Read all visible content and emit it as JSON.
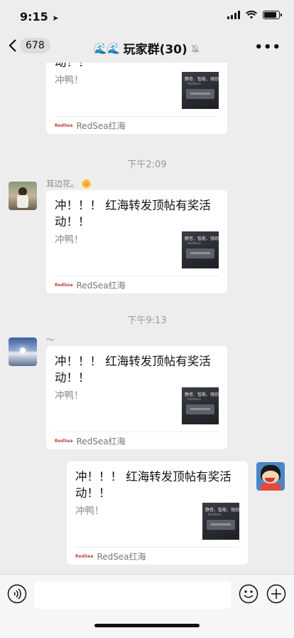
{
  "status": {
    "time": "9:15",
    "location_icon": "location-arrow-icon"
  },
  "nav": {
    "back_count": "678",
    "title": "玩家群(30)",
    "mute_icon": "bell-off-icon",
    "more_icon": "more-icon"
  },
  "timestamps": [
    "下午2:09",
    "下午9:13"
  ],
  "senders": [
    {
      "name": "耳边花。",
      "emoji": "🌼"
    },
    {
      "name": "～",
      "emoji": ""
    }
  ],
  "cards": [
    {
      "title_tail": "动！！",
      "desc": "冲鸭！",
      "source": "RedSea红海"
    },
    {
      "title": "冲！！！ 红海转发顶帖有奖活动！！",
      "desc": "冲鸭！",
      "source": "RedSea红海"
    },
    {
      "title": "冲！！！ 红海转发顶帖有奖活动！！",
      "desc": "冲鸭！",
      "source": "RedSea红海"
    },
    {
      "title": "冲！！！ 红海转发顶帖有奖活动！！",
      "desc": "冲鸭！",
      "source": "RedSea红海"
    }
  ],
  "thumbnail": {
    "line1": "静音、智能、强劲",
    "line2": "ReefDose"
  },
  "mini_logo": "RedSea",
  "input": {
    "voice_icon": "voice-icon",
    "emoji_icon": "emoji-icon",
    "plus_icon": "plus-icon"
  },
  "colors": {
    "background": "#ededed",
    "bubble": "#ffffff",
    "muted": "#9a9a9a"
  }
}
